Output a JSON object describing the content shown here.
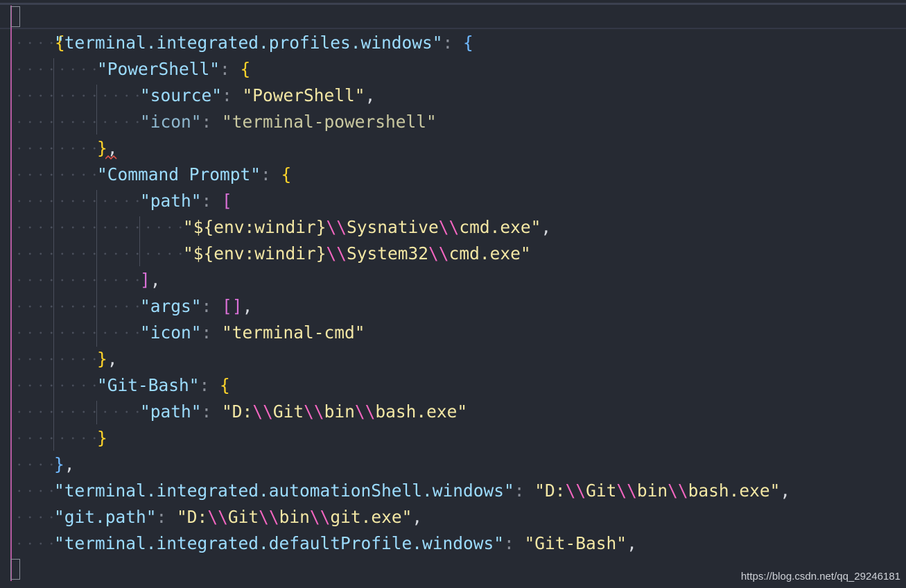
{
  "editor": {
    "open_brace": "{",
    "close_brace": "}",
    "lines": [
      {
        "k": "\"terminal.integrated.profiles.windows\"",
        "t": ": {"
      },
      {
        "k": "\"PowerShell\"",
        "t": ": {"
      },
      {
        "k": "\"source\"",
        "t": ": \"PowerShell\","
      },
      {
        "k": "\"icon\"",
        "t": ": \"terminal-powershell\""
      },
      {
        "k": "",
        "t": "},"
      },
      {
        "k": "\"Command Prompt\"",
        "t": ": {"
      },
      {
        "k": "\"path\"",
        "t": ": ["
      },
      {
        "k": "",
        "t": "\"${env:windir}\\\\Sysnative\\\\cmd.exe\","
      },
      {
        "k": "",
        "t": "\"${env:windir}\\\\System32\\\\cmd.exe\""
      },
      {
        "k": "",
        "t": "],"
      },
      {
        "k": "\"args\"",
        "t": ": [],"
      },
      {
        "k": "\"icon\"",
        "t": ": \"terminal-cmd\""
      },
      {
        "k": "",
        "t": "},"
      },
      {
        "k": "\"Git-Bash\"",
        "t": ": {"
      },
      {
        "k": "\"path\"",
        "t": ": \"D:\\\\Git\\\\bin\\\\bash.exe\""
      },
      {
        "k": "",
        "t": "}"
      },
      {
        "k": "",
        "t": "},"
      },
      {
        "k": "\"terminal.integrated.automationShell.windows\"",
        "t": ": \"D:\\\\Git\\\\bin\\\\bash.exe\","
      },
      {
        "k": "\"git.path\"",
        "t": ": \"D:\\\\Git\\\\bin\\\\git.exe\","
      },
      {
        "k": "\"terminal.integrated.defaultProfile.windows\"",
        "t": ": \"Git-Bash\","
      }
    ]
  },
  "watermark": "https://blog.csdn.net/qq_29246181",
  "colors": {
    "background": "#262a33",
    "key": "#9cdcfe",
    "string": "#f3e7a4",
    "escape": "#f266c0",
    "bracket_level1": "#ffd42a",
    "bracket_level2": "#da70d6",
    "bracket_level3": "#6fb8ff"
  }
}
